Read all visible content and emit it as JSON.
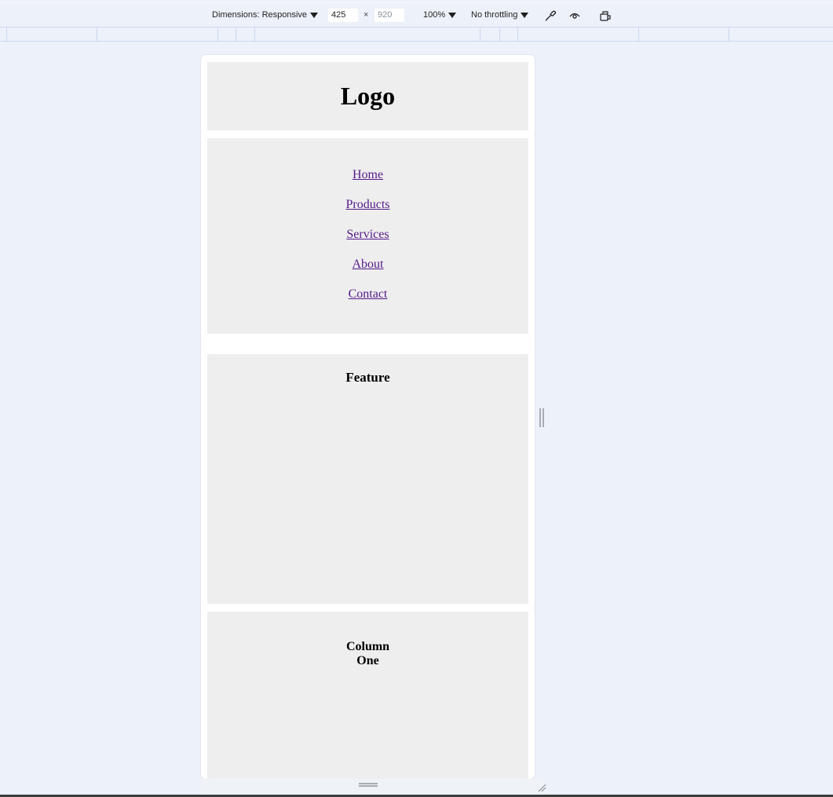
{
  "toolbar": {
    "dimensions_label": "Dimensions: Responsive",
    "width_value": "425",
    "height_placeholder": "920",
    "times": "×",
    "zoom": "100%",
    "throttling": "No throttling",
    "icons": [
      "eyedropper-icon",
      "eye-icon",
      "rotate-device-icon"
    ]
  },
  "page": {
    "logo": "Logo",
    "nav": [
      "Home",
      "Products",
      "Services",
      "About",
      "Contact"
    ],
    "feature_title": "Feature",
    "column_title": "Column One"
  },
  "colors": {
    "devtools_bg": "#edf1f9",
    "box_bg": "#eeeeee",
    "link": "#551a8b"
  }
}
